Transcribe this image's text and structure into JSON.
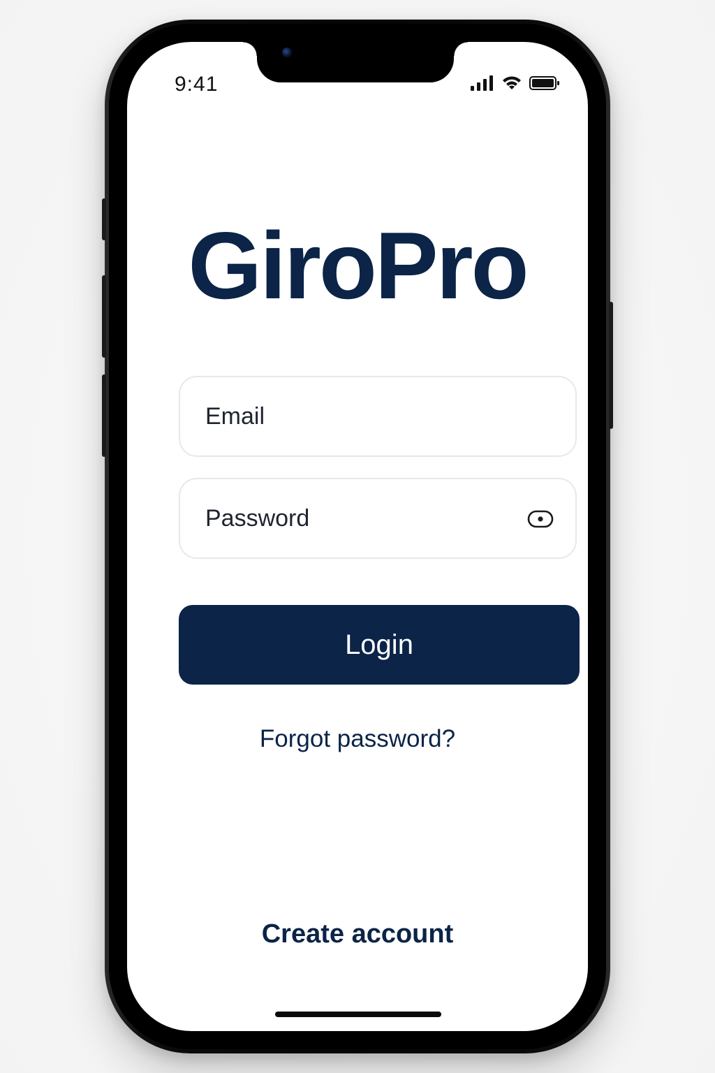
{
  "status_bar": {
    "time": "9:41",
    "icons": [
      "cellular-signal-icon",
      "wifi-icon",
      "battery-icon"
    ]
  },
  "app": {
    "brand": "GiroPro"
  },
  "form": {
    "email_placeholder": "Email",
    "password_placeholder": "Password",
    "password_toggle_icon": "eye-icon",
    "login_label": "Login",
    "forgot_label": "Forgot password?",
    "create_label": "Create account"
  },
  "colors": {
    "primary": "#0b2447",
    "background": "#ffffff",
    "field_border": "#e8e8e8"
  }
}
